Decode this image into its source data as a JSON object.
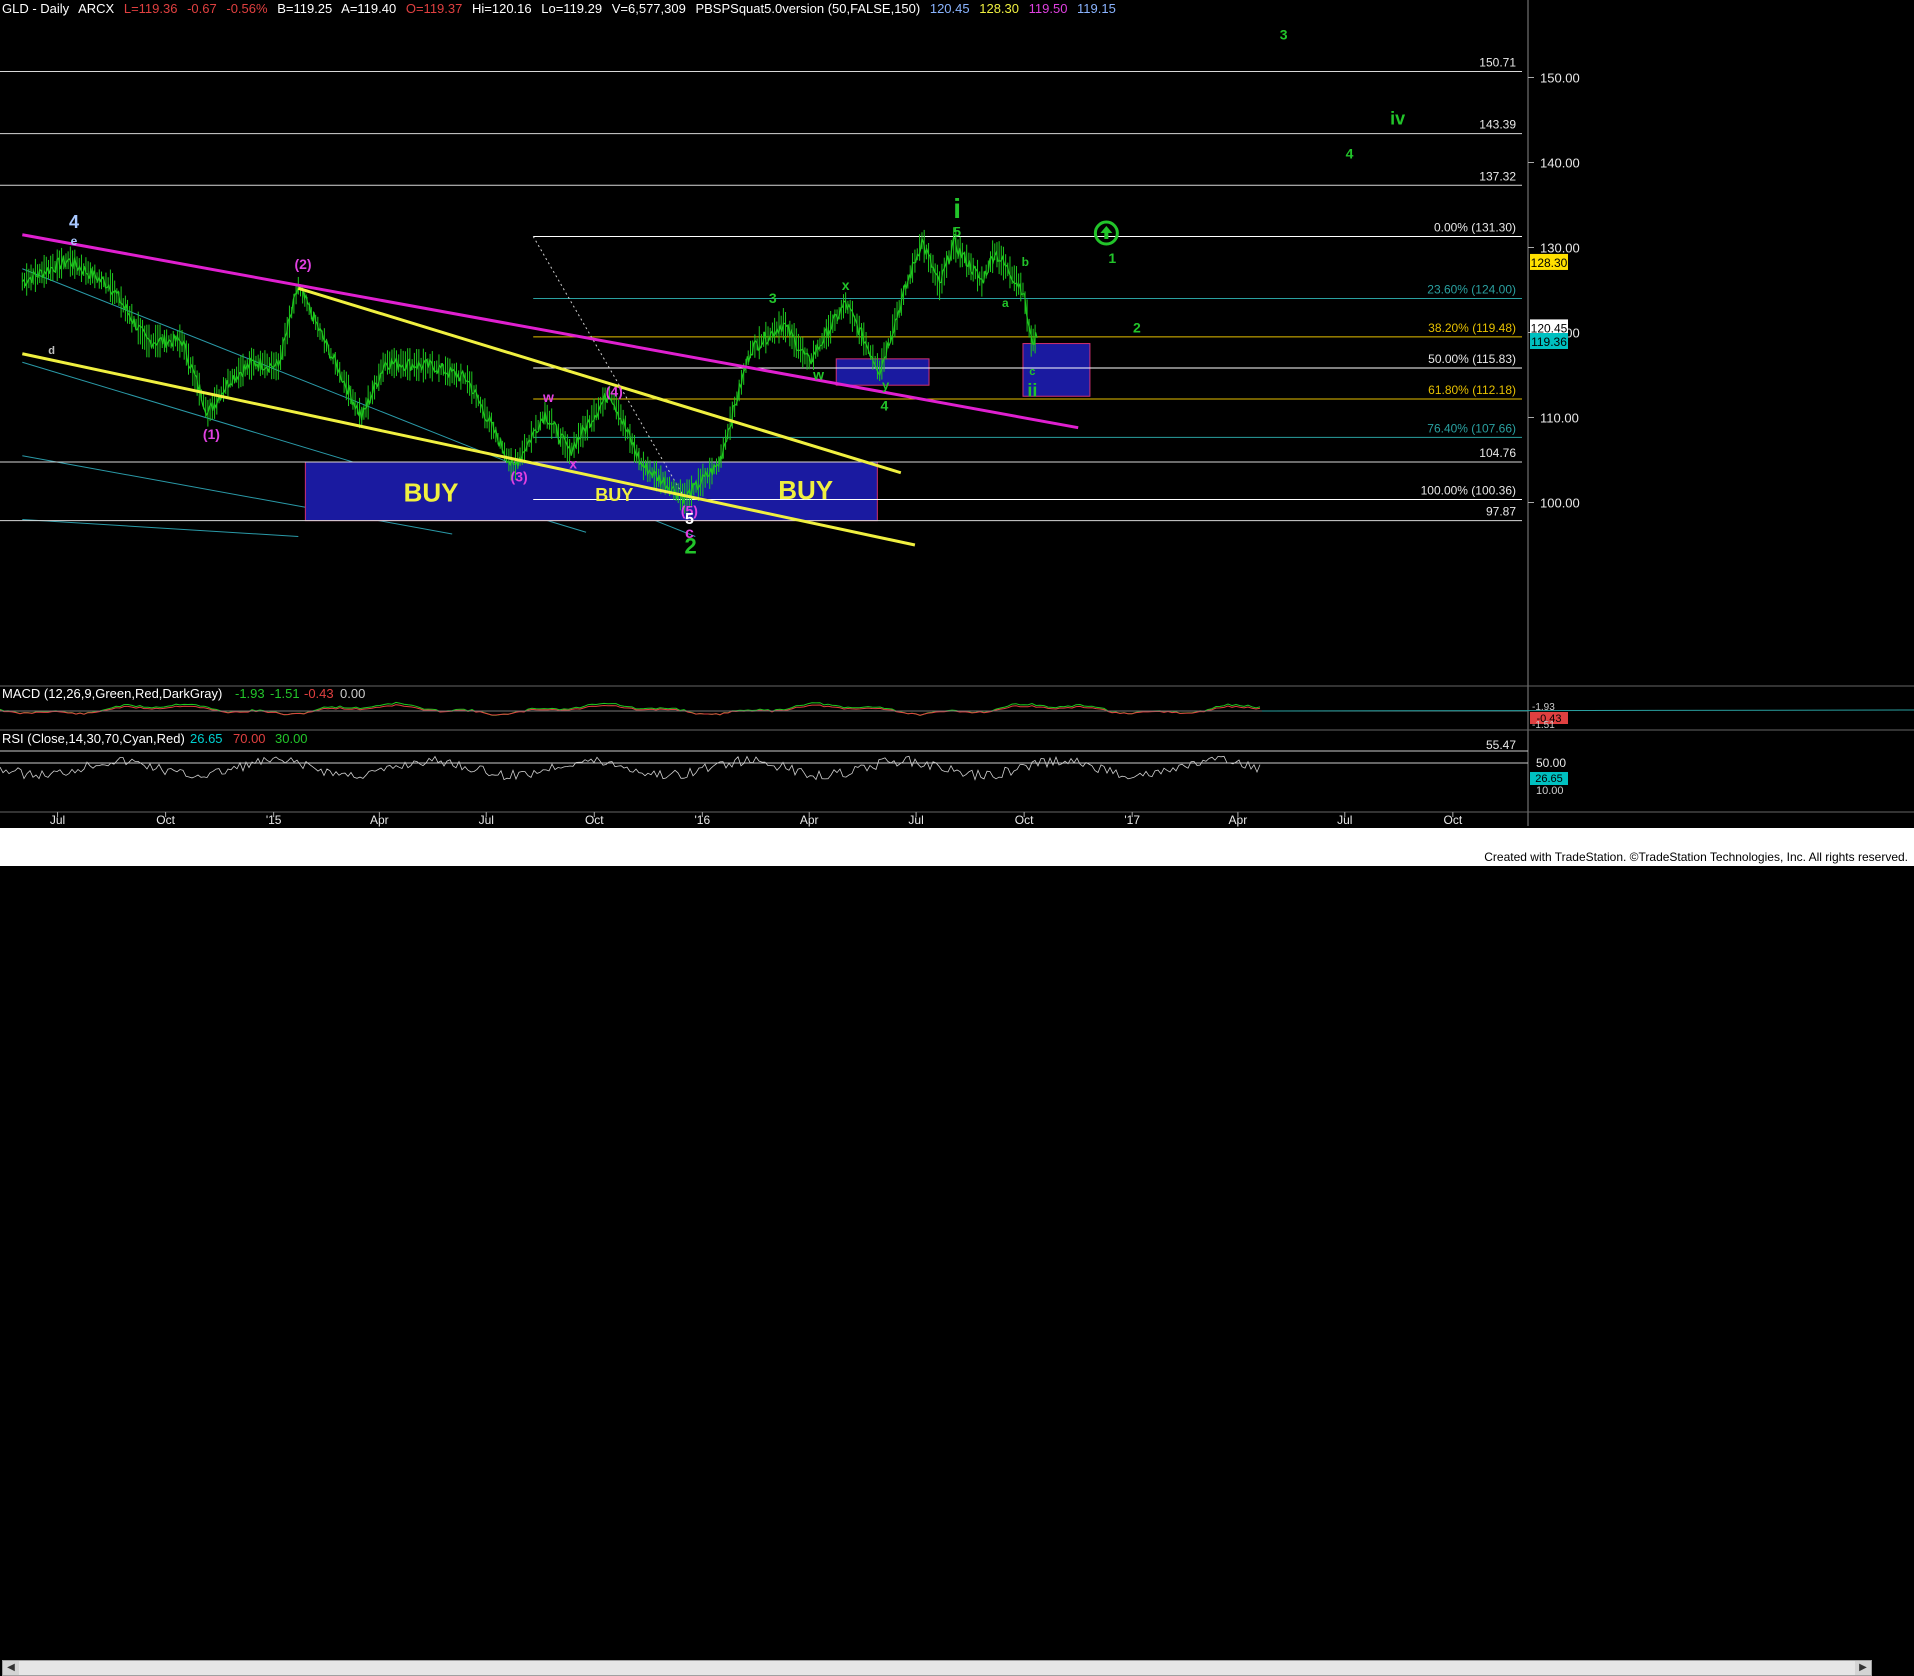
{
  "header": {
    "symbol": "GLD - Daily",
    "exchange": "ARCX",
    "last": "L=119.36",
    "change": "-0.67",
    "change_pct": "-0.56%",
    "bid": "B=119.25",
    "ask": "A=119.40",
    "open": "O=119.37",
    "high": "Hi=120.16",
    "low": "Lo=119.29",
    "volume": "V=6,577,309",
    "indicator": "PBSPSquat5.0version (50,FALSE,150)",
    "ind_v1": "120.45",
    "ind_v2": "128.30",
    "ind_v3": "119.50",
    "ind_v4": "119.15"
  },
  "colors": {
    "background": "#000000",
    "wave_green": "#22c42a",
    "wave_magenta": "#e040e0",
    "yellow_line": "#f0f040",
    "magenta_line": "#e020d0",
    "buy_box": "#1a1aa0",
    "fib_line": "#2aa0a0"
  },
  "chart_data": {
    "type": "line",
    "title": "GLD - Daily",
    "y_axis_ticks": [
      "150.00",
      "140.00",
      "130.00",
      "120.00",
      "110.00",
      "100.00"
    ],
    "ylim": [
      93,
      157
    ],
    "x_axis_ticks": [
      "Jul",
      "Oct",
      "'15",
      "Apr",
      "Jul",
      "Oct",
      "'16",
      "Apr",
      "Jul",
      "Oct",
      "'17",
      "Apr",
      "Jul",
      "Oct"
    ],
    "price_series": {
      "name": "GLD",
      "points": [
        [
          "2014-06-01",
          126.0
        ],
        [
          "2014-07-10",
          128.5
        ],
        [
          "2014-08-15",
          125.5
        ],
        [
          "2014-09-15",
          119.0
        ],
        [
          "2014-10-15",
          119.0
        ],
        [
          "2014-11-06",
          110.5
        ],
        [
          "2014-11-25",
          114.5
        ],
        [
          "2014-12-15",
          116.5
        ],
        [
          "2015-01-05",
          116.0
        ],
        [
          "2015-01-22",
          125.5
        ],
        [
          "2015-02-15",
          118.5
        ],
        [
          "2015-03-17",
          110.0
        ],
        [
          "2015-04-06",
          116.5
        ],
        [
          "2015-05-18",
          116.0
        ],
        [
          "2015-06-15",
          114.5
        ],
        [
          "2015-07-24",
          104.0
        ],
        [
          "2015-08-20",
          110.5
        ],
        [
          "2015-09-10",
          106.0
        ],
        [
          "2015-10-14",
          113.0
        ],
        [
          "2015-11-10",
          104.5
        ],
        [
          "2015-12-17",
          100.5
        ],
        [
          "2016-01-15",
          104.5
        ],
        [
          "2016-02-11",
          118.0
        ],
        [
          "2016-03-10",
          121.0
        ],
        [
          "2016-04-01",
          116.5
        ],
        [
          "2016-05-02",
          123.5
        ],
        [
          "2016-05-31",
          115.5
        ],
        [
          "2016-06-24",
          126.0
        ],
        [
          "2016-07-06",
          130.8
        ],
        [
          "2016-07-21",
          125.5
        ],
        [
          "2016-08-02",
          130.5
        ],
        [
          "2016-08-26",
          126.0
        ],
        [
          "2016-09-06",
          129.5
        ],
        [
          "2016-09-30",
          125.0
        ],
        [
          "2016-10-07",
          119.0
        ],
        [
          "2016-10-12",
          119.36
        ]
      ]
    },
    "horizontal_levels": [
      {
        "label": "150.71",
        "value": 150.71
      },
      {
        "label": "143.39",
        "value": 143.39
      },
      {
        "label": "137.32",
        "value": 137.32
      },
      {
        "label": "104.76",
        "value": 104.76
      },
      {
        "label": "97.87",
        "value": 97.87
      }
    ],
    "fib_levels": [
      {
        "label": "0.00% (131.30)",
        "value": 131.3,
        "color": "#ffffff"
      },
      {
        "label": "23.60% (124.00)",
        "value": 124.0,
        "color": "#2aa0a0"
      },
      {
        "label": "38.20% (119.48)",
        "value": 119.48,
        "color": "#e6c000"
      },
      {
        "label": "50.00% (115.83)",
        "value": 115.83,
        "color": "#ffffff"
      },
      {
        "label": "61.80% (112.18)",
        "value": 112.18,
        "color": "#e6c000"
      },
      {
        "label": "76.40% (107.66)",
        "value": 107.66,
        "color": "#2aa0a0"
      },
      {
        "label": "100.00% (100.36)",
        "value": 100.36,
        "color": "#ffffff"
      }
    ],
    "price_boxes": [
      {
        "label": "128.30",
        "value": 128.3,
        "bg": "#ffe000",
        "fg": "#000000"
      },
      {
        "label": "120.45",
        "value": 120.6,
        "bg": "#ffffff",
        "fg": "#000000"
      },
      {
        "label": "119.36",
        "value": 119.0,
        "bg": "#00c0c0",
        "fg": "#000000"
      }
    ],
    "buy_boxes": [
      {
        "label": "BUY",
        "x0": "2015-01-28",
        "x1": "2016-05-29",
        "y0": 97.87,
        "y1": 104.76,
        "color": "#1a1aa0"
      }
    ],
    "buy_labels": [
      {
        "label": "BUY",
        "x": "2015-05-15",
        "y": 100.1,
        "size": 26
      },
      {
        "label": "BUY",
        "x": "2015-10-18",
        "y": 100.2,
        "size": 18
      },
      {
        "label": "BUY",
        "x": "2016-03-29",
        "y": 100.4,
        "size": 26
      }
    ],
    "small_boxes": [
      {
        "x0": "2016-04-24",
        "x1": "2016-07-12",
        "y0": 113.8,
        "y1": 116.9,
        "color": "#1a1aa0"
      },
      {
        "x0": "2016-09-30",
        "x1": "2016-11-26",
        "y0": 112.5,
        "y1": 118.7,
        "color": "#1a1aa0"
      }
    ],
    "trend_lines": [
      {
        "name": "magenta-trendline",
        "color": "#e020d0",
        "width": 3,
        "p1": [
          "2014-06-01",
          131.5
        ],
        "p2": [
          "2016-11-16",
          108.8
        ]
      },
      {
        "name": "yellow-upper-line",
        "color": "#f0f040",
        "width": 3,
        "p1": [
          "2015-01-22",
          125.2
        ],
        "p2": [
          "2016-06-18",
          103.5
        ]
      },
      {
        "name": "yellow-lower-line",
        "color": "#f0f040",
        "width": 3,
        "p1": [
          "2014-06-01",
          117.5
        ],
        "p2": [
          "2016-06-30",
          95.0
        ]
      }
    ],
    "channel_lines": [
      {
        "p1": [
          "2014-06-01",
          127.5
        ],
        "p2": [
          "2015-12-26",
          96.0
        ]
      },
      {
        "p1": [
          "2014-06-01",
          116.5
        ],
        "p2": [
          "2015-09-24",
          96.5
        ]
      },
      {
        "p1": [
          "2014-06-01",
          105.5
        ],
        "p2": [
          "2015-06-02",
          96.3
        ]
      },
      {
        "p1": [
          "2014-06-01",
          98.0
        ],
        "p2": [
          "2015-01-22",
          96.0
        ]
      }
    ],
    "dotted_lines": [
      {
        "p1": [
          "2015-08-10",
          131.3
        ],
        "p2": [
          "2015-12-17",
          100.5
        ]
      }
    ],
    "wave_labels": [
      {
        "text": "4",
        "x": "2014-07-15",
        "y": 132.3,
        "color": "#a8c8ff",
        "size": 18
      },
      {
        "text": "e",
        "x": "2014-07-15",
        "y": 130.3,
        "color": "#a8c8ff",
        "size": 12
      },
      {
        "text": "d",
        "x": "2014-06-26",
        "y": 117.5,
        "color": "#c0c0c0",
        "size": 11
      },
      {
        "text": "(2)",
        "x": "2015-01-26",
        "y": 127.5,
        "color": "#e040e0",
        "size": 14
      },
      {
        "text": "(1)",
        "x": "2014-11-09",
        "y": 107.5,
        "color": "#e040e0",
        "size": 14
      },
      {
        "text": "(3)",
        "x": "2015-07-29",
        "y": 102.5,
        "color": "#e040e0",
        "size": 14
      },
      {
        "text": "w",
        "x": "2015-08-23",
        "y": 111.8,
        "color": "#e040e0",
        "size": 14
      },
      {
        "text": "x",
        "x": "2015-09-13",
        "y": 104.0,
        "color": "#e040e0",
        "size": 14
      },
      {
        "text": "(4)",
        "x": "2015-10-18",
        "y": 112.5,
        "color": "#e040e0",
        "size": 14
      },
      {
        "text": "(5)",
        "x": "2015-12-21",
        "y": 98.5,
        "color": "#e040e0",
        "size": 14
      },
      {
        "text": "5",
        "x": "2015-12-21",
        "y": 97.5,
        "color": "#ffffff",
        "size": 16
      },
      {
        "text": "c",
        "x": "2015-12-21",
        "y": 95.8,
        "color": "#e040e0",
        "size": 16
      },
      {
        "text": "2",
        "x": "2015-12-22",
        "y": 94.0,
        "color": "#22c42a",
        "size": 22
      },
      {
        "text": "3",
        "x": "2016-03-01",
        "y": 123.5,
        "color": "#22c42a",
        "size": 14
      },
      {
        "text": "w",
        "x": "2016-04-09",
        "y": 114.5,
        "color": "#22c42a",
        "size": 14
      },
      {
        "text": "x",
        "x": "2016-05-02",
        "y": 125.0,
        "color": "#22c42a",
        "size": 14
      },
      {
        "text": "y",
        "x": "2016-06-05",
        "y": 113.3,
        "color": "#22c42a",
        "size": 13
      },
      {
        "text": "4",
        "x": "2016-06-04",
        "y": 110.8,
        "color": "#22c42a",
        "size": 14
      },
      {
        "text": "i",
        "x": "2016-08-05",
        "y": 133.5,
        "color": "#22c42a",
        "size": 28
      },
      {
        "text": "5",
        "x": "2016-08-05",
        "y": 131.3,
        "color": "#22c42a",
        "size": 14
      },
      {
        "text": "b",
        "x": "2016-10-02",
        "y": 127.8,
        "color": "#22c42a",
        "size": 12
      },
      {
        "text": "a",
        "x": "2016-09-15",
        "y": 123.0,
        "color": "#22c42a",
        "size": 12
      },
      {
        "text": "c",
        "x": "2016-10-08",
        "y": 115.0,
        "color": "#22c42a",
        "size": 11
      },
      {
        "text": "ii",
        "x": "2016-10-08",
        "y": 112.5,
        "color": "#22c42a",
        "size": 18
      },
      {
        "text": "1",
        "x": "2016-12-15",
        "y": 128.2,
        "color": "#22c42a",
        "size": 14
      },
      {
        "text": "2",
        "x": "2017-01-05",
        "y": 120.0,
        "color": "#22c42a",
        "size": 14
      },
      {
        "text": "3",
        "x": "2017-05-10",
        "y": 154.5,
        "color": "#22c42a",
        "size": 14
      },
      {
        "text": "4",
        "x": "2017-07-05",
        "y": 140.5,
        "color": "#22c42a",
        "size": 14
      },
      {
        "text": "iv",
        "x": "2017-08-15",
        "y": 144.5,
        "color": "#22c42a",
        "size": 18
      }
    ],
    "up_arrow": {
      "x": "2016-12-10",
      "y": 131.7,
      "color": "#22c42a"
    },
    "macd": {
      "label": "MACD (12,26,9,Green,Red,DarkGray)",
      "v1": "-1.93",
      "v2": "-1.51",
      "v3": "-0.43",
      "v4": "0.00",
      "right_labels": [
        "-1.93",
        "-1.51",
        "-0.43"
      ]
    },
    "rsi": {
      "label": "RSI (Close,14,30,70,Cyan,Red)",
      "v1": "26.65",
      "v2": "70.00",
      "v3": "30.00",
      "right_labels": [
        "55.47",
        "50.00",
        "26.65",
        "10.00"
      ]
    }
  },
  "footer": {
    "credit": "Created with TradeStation. ©TradeStation Technologies, Inc. All rights reserved."
  }
}
